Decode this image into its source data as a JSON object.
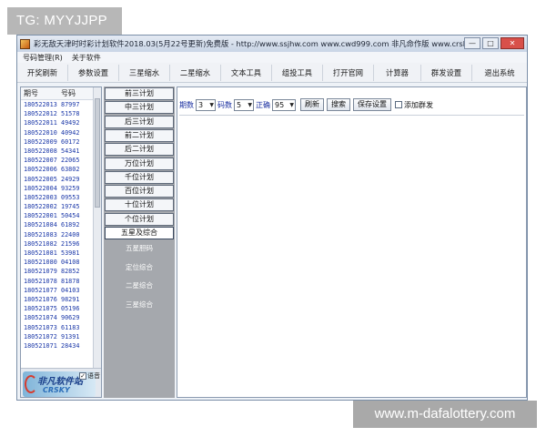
{
  "watermarks": {
    "top": "TG: MYYJJPP",
    "bottom": "www.m-dafalottery.com"
  },
  "window": {
    "title": "彩无敌天津时时彩计划软件2018.03(5月22号更新)免费版 - http://www.ssjhw.com www.cwd999.com 非凡命作版 www.crsky.com",
    "controls": {
      "minimize": "—",
      "maximize": "□",
      "close": "✕"
    }
  },
  "menu": [
    "号码管理(R)",
    "关于软件"
  ],
  "toolbar": [
    "开奖刷新",
    "参数设置",
    "三星缩水",
    "二星缩水",
    "文本工具",
    "组投工具",
    "打开官网",
    "计算器",
    "群发设置",
    "退出系统"
  ],
  "history": {
    "headers": [
      "期号",
      "号码"
    ],
    "rows": [
      [
        "180522013",
        "87997"
      ],
      [
        "180522012",
        "51578"
      ],
      [
        "180522011",
        "49492"
      ],
      [
        "180522010",
        "40942"
      ],
      [
        "180522009",
        "60172"
      ],
      [
        "180522008",
        "54341"
      ],
      [
        "180522007",
        "22065"
      ],
      [
        "180522006",
        "63802"
      ],
      [
        "180522005",
        "24929"
      ],
      [
        "180522004",
        "93259"
      ],
      [
        "180522003",
        "09553"
      ],
      [
        "180522002",
        "19745"
      ],
      [
        "180522001",
        "50454"
      ],
      [
        "180521084",
        "61892"
      ],
      [
        "180521083",
        "22400"
      ],
      [
        "180521082",
        "21596"
      ],
      [
        "180521081",
        "53981"
      ],
      [
        "180521080",
        "04108"
      ],
      [
        "180521079",
        "82852"
      ],
      [
        "180521078",
        "81878"
      ],
      [
        "180521077",
        "04103"
      ],
      [
        "180521076",
        "98291"
      ],
      [
        "180521075",
        "05196"
      ],
      [
        "180521074",
        "90629"
      ],
      [
        "180521073",
        "61183"
      ],
      [
        "180521072",
        "91391"
      ],
      [
        "180521071",
        "28434"
      ]
    ]
  },
  "logo": {
    "text": "非凡软件站",
    "sub": "CRSKY",
    "sound_label": "语音"
  },
  "plans": {
    "buttons": [
      "前三计划",
      "中三计划",
      "后三计划",
      "前二计划",
      "后二计划",
      "万位计划",
      "千位计划",
      "百位计划",
      "十位计划",
      "个位计划",
      "五星及综合"
    ],
    "active_index": 10,
    "sub_items": [
      "五星胆码",
      "定位综合",
      "二星综合",
      "三星综合"
    ]
  },
  "controls": {
    "period_label": "期数",
    "period_value": "3",
    "code_label": "码数",
    "code_value": "5",
    "accuracy_label": "正确",
    "accuracy_value": "95",
    "refresh": "刷新",
    "search": "搜索",
    "save": "保存设置",
    "add_group": "添加群发"
  }
}
